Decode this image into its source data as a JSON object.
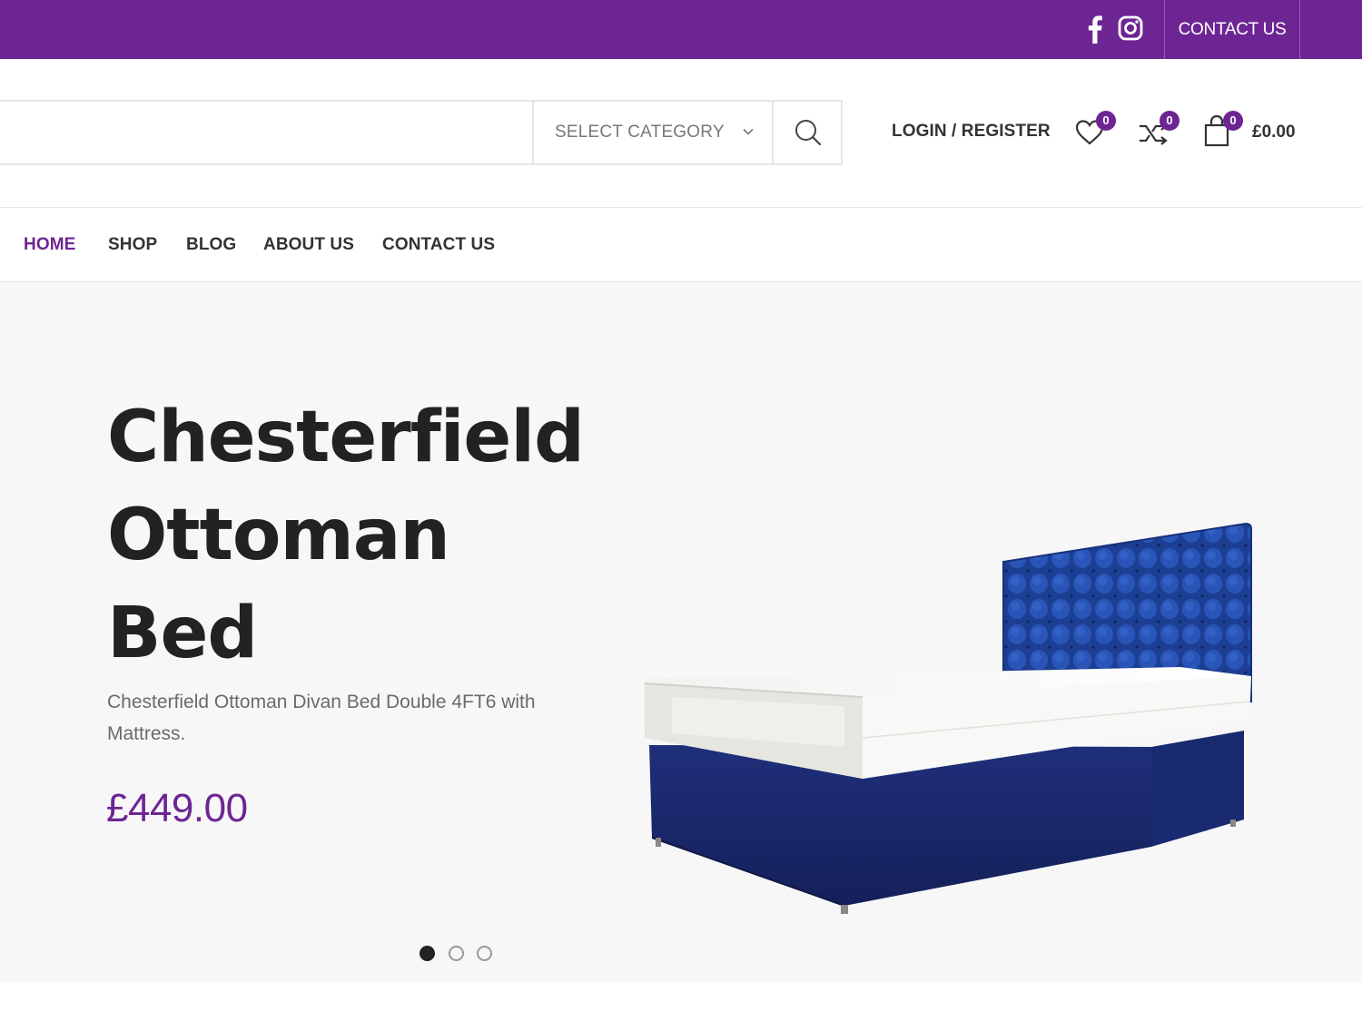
{
  "topbar": {
    "social": [
      "facebook-icon",
      "instagram-icon"
    ],
    "contact_label": "CONTACT US",
    "bg_color": "#6e2594"
  },
  "header": {
    "search_placeholder": "",
    "category_label": "SELECT CATEGORY",
    "login_label": "LOGIN / REGISTER",
    "wishlist_count": "0",
    "compare_count": "0",
    "cart_count": "0",
    "cart_total": "£0.00"
  },
  "nav": {
    "items": [
      {
        "label": "HOME",
        "active": true
      },
      {
        "label": "SHOP",
        "active": false
      },
      {
        "label": "BLOG",
        "active": false
      },
      {
        "label": "ABOUT US",
        "active": false
      },
      {
        "label": "CONTACT US",
        "active": false
      }
    ],
    "accent_color": "#6e2594"
  },
  "hero": {
    "title_lines": [
      "Chesterfield",
      "Ottoman",
      "Bed"
    ],
    "description": "Chesterfield Ottoman Divan Bed Double 4FT6  with Mattress.",
    "price": "£449.00",
    "slides": 3,
    "active_slide": 1
  }
}
